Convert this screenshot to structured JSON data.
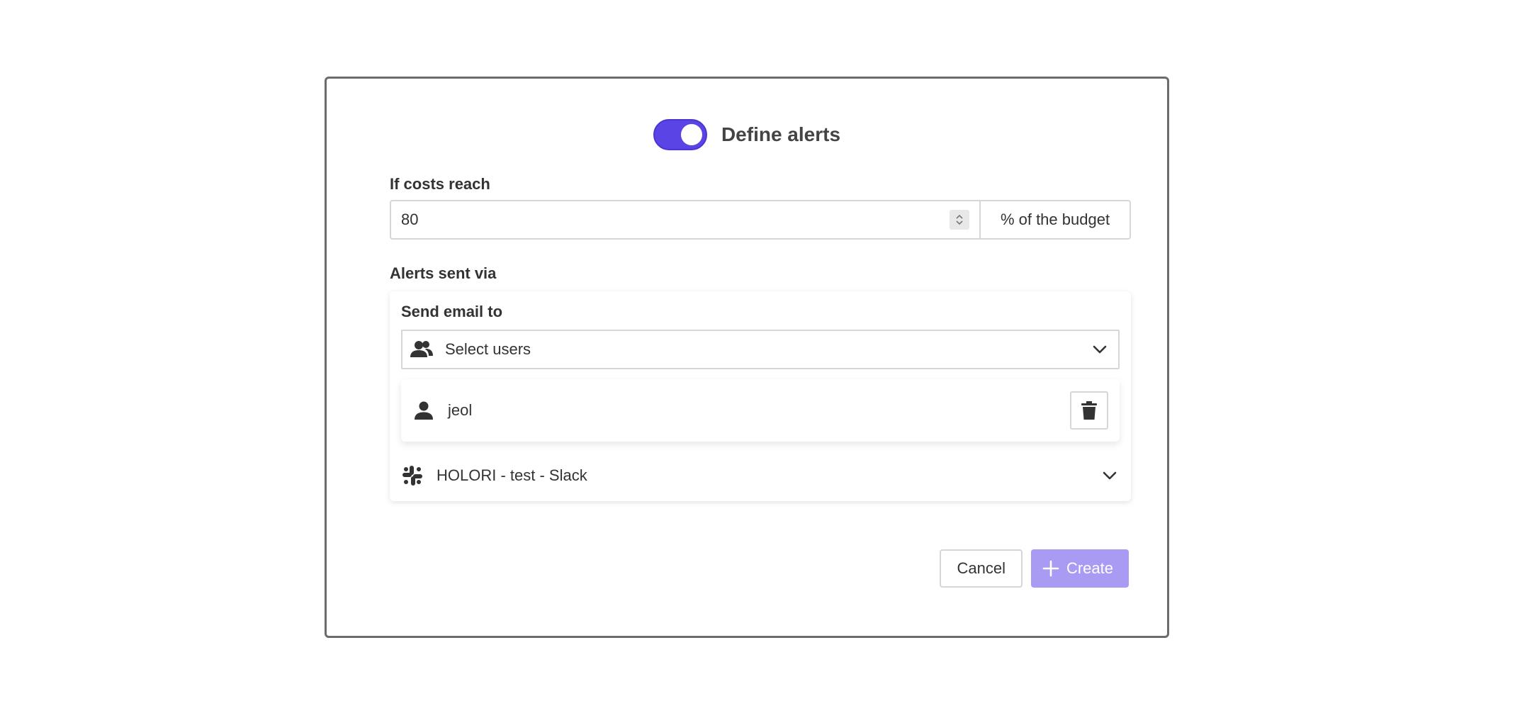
{
  "header": {
    "title": "Define alerts",
    "toggle_on": true
  },
  "costs": {
    "label": "If costs reach",
    "value": "80",
    "suffix": "% of the budget"
  },
  "alerts": {
    "label": "Alerts sent via",
    "email": {
      "label": "Send email to",
      "select_placeholder": "Select users",
      "users": [
        {
          "name": "jeol"
        }
      ]
    },
    "slack": {
      "label": "HOLORI - test - Slack"
    }
  },
  "actions": {
    "cancel_label": "Cancel",
    "create_label": "Create"
  },
  "colors": {
    "accent": "#5b44e6",
    "create_button": "#a99bf3",
    "border": "#d6d6d6",
    "modal_border": "#6b6b6b",
    "text": "#333333"
  },
  "icons": {
    "users": "users-icon",
    "person": "person-icon",
    "trash": "trash-icon",
    "slack": "slack-icon",
    "chevron": "chevron-down-icon",
    "plus": "plus-icon"
  }
}
